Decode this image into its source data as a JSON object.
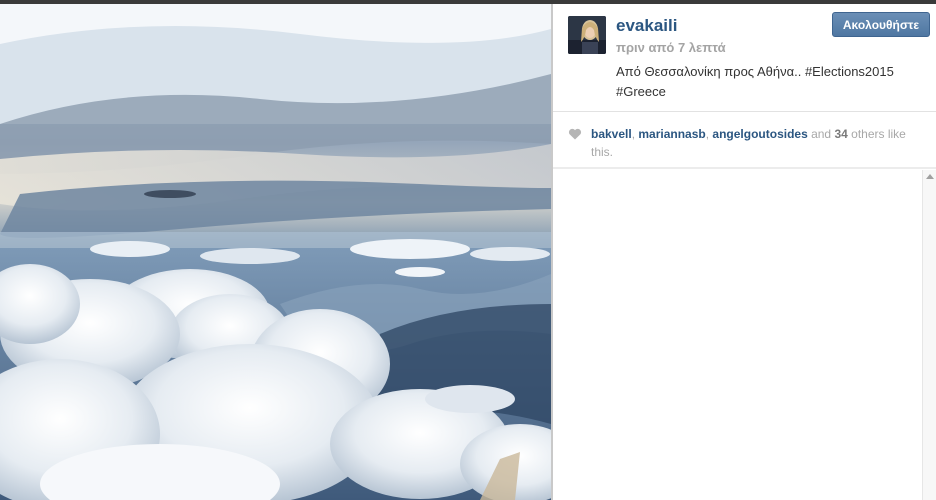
{
  "post": {
    "username": "evakaili",
    "time_ago": "πριν από 7 λεπτά",
    "caption_line1": "Από Θεσσαλονίκη προς Αθήνα.. #Elections2015",
    "caption_line2": "#Greece",
    "follow_button": "Ακολουθήστε"
  },
  "likes": {
    "likers": [
      "bakvell",
      "mariannasb",
      "angelgoutosides"
    ],
    "sep1": ", ",
    "sep2": ", ",
    "and_text": " and ",
    "count": "34",
    "tail": " others like this."
  },
  "icons": {
    "heart": "heart-icon",
    "scroll_up": "scroll-up-icon"
  },
  "colors": {
    "username": "#2b5681",
    "button": "#4f77a2",
    "muted": "#a4a4a4"
  }
}
